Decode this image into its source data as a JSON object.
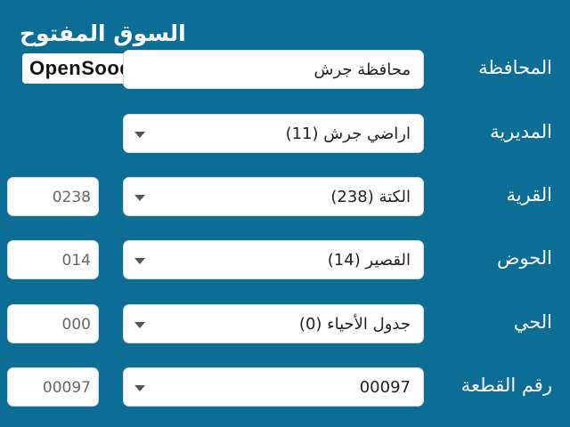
{
  "logo": {
    "arabic": "السوق المفتوح",
    "latin": "OpenSooq"
  },
  "form": {
    "governorate": {
      "label": "المحافظة",
      "value": "محافظة جرش"
    },
    "directorate": {
      "label": "المديرية",
      "value": "اراضي جرش (11)"
    },
    "village": {
      "label": "القرية",
      "value": "الكتة (238)",
      "code": "0238"
    },
    "basin": {
      "label": "الحوض",
      "value": "القصير (14)",
      "code": "014"
    },
    "neighborhood": {
      "label": "الحي",
      "value": "جدول الأحياء (0)",
      "code": "000"
    },
    "plot_number": {
      "label": "رقم القطعة",
      "value": "00097",
      "code": "00097"
    }
  },
  "icons": {
    "dropdown": "chevron-down-icon"
  },
  "colors": {
    "background": "#0c6e94",
    "field": "#ffffff",
    "label": "#ffffff"
  }
}
